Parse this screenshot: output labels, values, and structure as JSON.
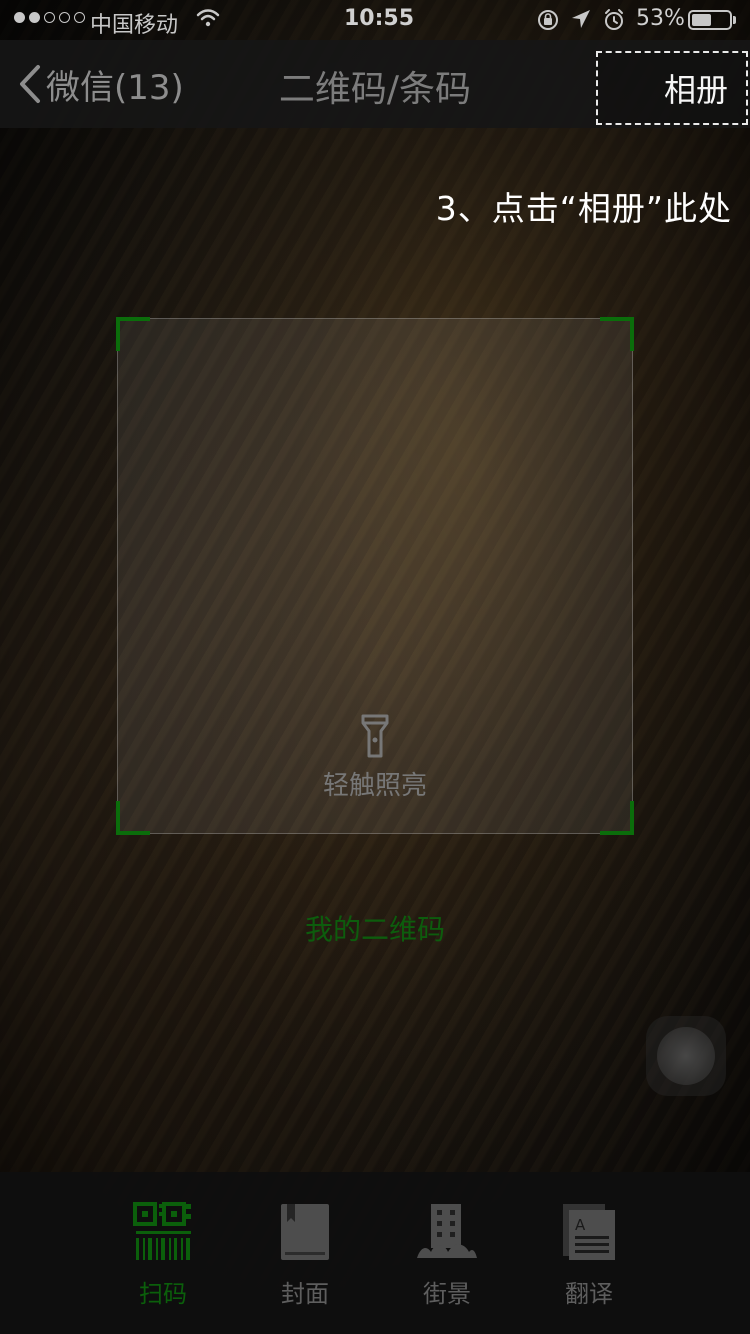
{
  "status_bar": {
    "signal_filled": 2,
    "signal_total": 5,
    "carrier": "中国移动",
    "time": "10:55",
    "battery_percent": "53%",
    "battery_level": 0.53,
    "icons": [
      "wifi-icon",
      "orientation-lock-icon",
      "location-icon",
      "alarm-icon",
      "battery-icon"
    ]
  },
  "nav": {
    "back_label": "微信(13)",
    "title": "二维码/条码",
    "album_label": "相册"
  },
  "instruction": "3、点击“相册”此处",
  "scanner": {
    "torch_label": "轻触照亮",
    "my_qr_code": "我的二维码"
  },
  "tabs": [
    {
      "label": "扫码",
      "icon": "qr-scan-icon",
      "active": true
    },
    {
      "label": "封面",
      "icon": "book-cover-icon",
      "active": false
    },
    {
      "label": "街景",
      "icon": "street-view-icon",
      "active": false
    },
    {
      "label": "翻译",
      "icon": "translate-icon",
      "active": false
    }
  ],
  "colors": {
    "accent_green": "#0b6d0b",
    "dark_text": "#7c7c7c",
    "white_text": "#ffffff"
  }
}
